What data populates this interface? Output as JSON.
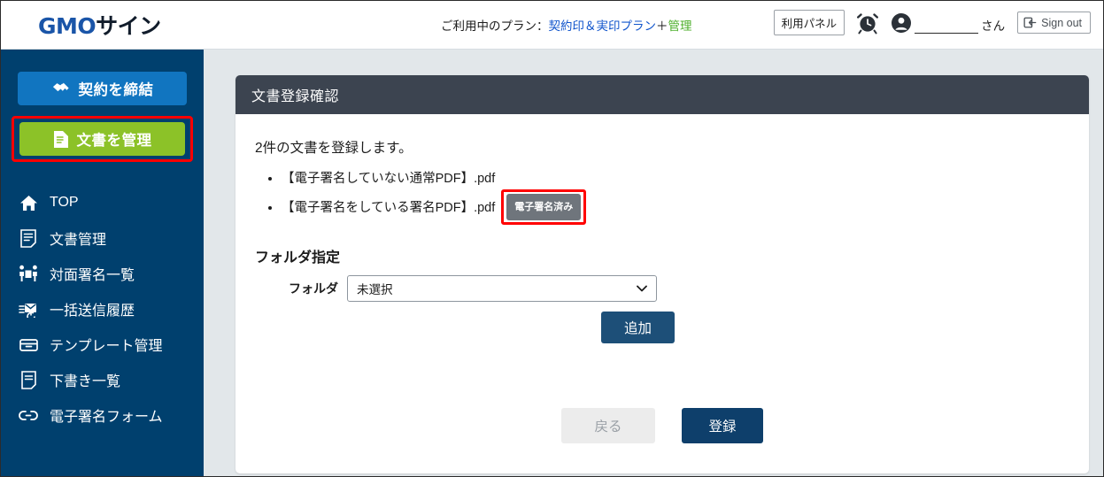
{
  "header": {
    "logo_gmo": "GMO",
    "logo_sign": "サイン",
    "plan_prefix": "ご利用中のプラン：",
    "plan_name": "契約印＆実印プラン",
    "plan_plus": "＋",
    "plan_option": "管理",
    "panel_button": "利用パネル",
    "alarm_icon": "alarm-clock-icon",
    "user_icon": "user-avatar-icon",
    "user_name_masked": "",
    "user_suffix": "さん",
    "signout_label": "Sign out",
    "signout_icon": "sign-out-icon"
  },
  "sidebar": {
    "primary_buttons": [
      {
        "label": "契約を締結",
        "icon": "handshake-icon",
        "color": "#1175c0",
        "highlighted": false
      },
      {
        "label": "文書を管理",
        "icon": "document-icon",
        "color": "#8cc228",
        "highlighted": true
      }
    ],
    "items": [
      {
        "label": "TOP",
        "icon": "home-icon"
      },
      {
        "label": "文書管理",
        "icon": "document-list-icon"
      },
      {
        "label": "対面署名一覧",
        "icon": "face-to-face-signing-icon"
      },
      {
        "label": "一括送信履歴",
        "icon": "bulk-send-history-icon"
      },
      {
        "label": "テンプレート管理",
        "icon": "template-box-icon"
      },
      {
        "label": "下書き一覧",
        "icon": "draft-icon"
      },
      {
        "label": "電子署名フォーム",
        "icon": "link-icon"
      }
    ]
  },
  "main": {
    "panel_title": "文書登録確認",
    "lead_text": "2件の文書を登録します。",
    "documents": [
      {
        "name": "【電子署名していない通常PDF】.pdf",
        "badge": null
      },
      {
        "name": "【電子署名をしている署名PDF】.pdf",
        "badge": "電子署名済み"
      }
    ],
    "folder_section_title": "フォルダ指定",
    "folder_label": "フォルダ",
    "folder_selected": "未選択",
    "folder_options": [
      "未選択"
    ],
    "add_button": "追加",
    "back_button": "戻る",
    "submit_button": "登録"
  },
  "colors": {
    "sidebar_bg": "#00406e",
    "primary_blue": "#1175c0",
    "accent_green": "#8cc228",
    "panel_header": "#3c4450",
    "submit_blue": "#0e3f6b",
    "highlight_red": "#ff0000",
    "badge_gray": "#6f757c",
    "content_bg": "#e2e7ea"
  }
}
